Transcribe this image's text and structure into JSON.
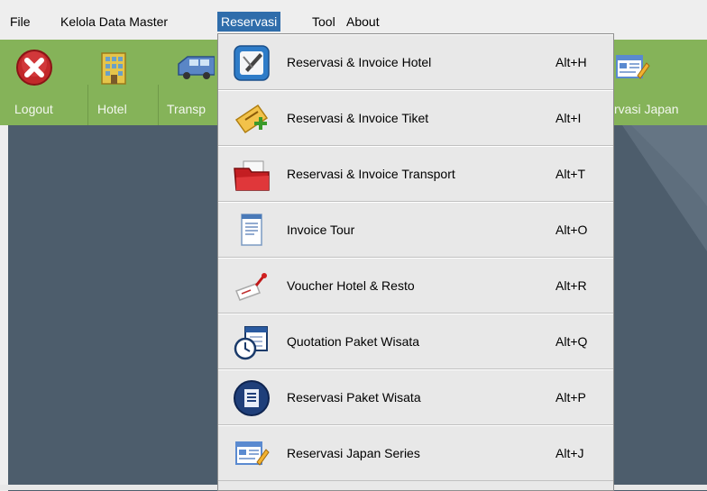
{
  "menubar": {
    "items": [
      {
        "label": "File"
      },
      {
        "label": "Kelola Data Master"
      },
      {
        "label": "Reservasi"
      },
      {
        "label": "Tool"
      },
      {
        "label": "About"
      }
    ]
  },
  "toolbar": {
    "buttons": [
      {
        "label": "Logout",
        "icon": "close-circle-icon"
      },
      {
        "label": "Hotel",
        "icon": "hotel-building-icon"
      },
      {
        "label": "Transp",
        "icon": "van-icon"
      },
      {
        "label": "rvasi Japan",
        "icon": "form-edit-icon"
      }
    ]
  },
  "dropdown": {
    "items": [
      {
        "label": "Reservasi &  Invoice Hotel",
        "accel": "Alt+H",
        "icon": "pen-note-icon"
      },
      {
        "label": "Reservasi & Invoice Tiket",
        "accel": "Alt+I",
        "icon": "ticket-add-icon"
      },
      {
        "label": "Reservasi & Invoice Transport",
        "accel": "Alt+T",
        "icon": "red-folder-icon"
      },
      {
        "label": "Invoice Tour",
        "accel": "Alt+O",
        "icon": "document-icon"
      },
      {
        "label": "Voucher Hotel & Resto",
        "accel": "Alt+R",
        "icon": "voucher-pin-icon"
      },
      {
        "label": "Quotation Paket Wisata",
        "accel": "Alt+Q",
        "icon": "clock-calendar-icon"
      },
      {
        "label": "Reservasi Paket Wisata",
        "accel": "Alt+P",
        "icon": "list-badge-icon"
      },
      {
        "label": "Reservasi Japan Series",
        "accel": "Alt+J",
        "icon": "form-edit-icon"
      }
    ]
  },
  "colors": {
    "toolbar_bg": "#85b359",
    "menu_highlight": "#2f6dab",
    "desktop_bg": "#4d5d6c",
    "menu_bg": "#e8e8e8"
  }
}
